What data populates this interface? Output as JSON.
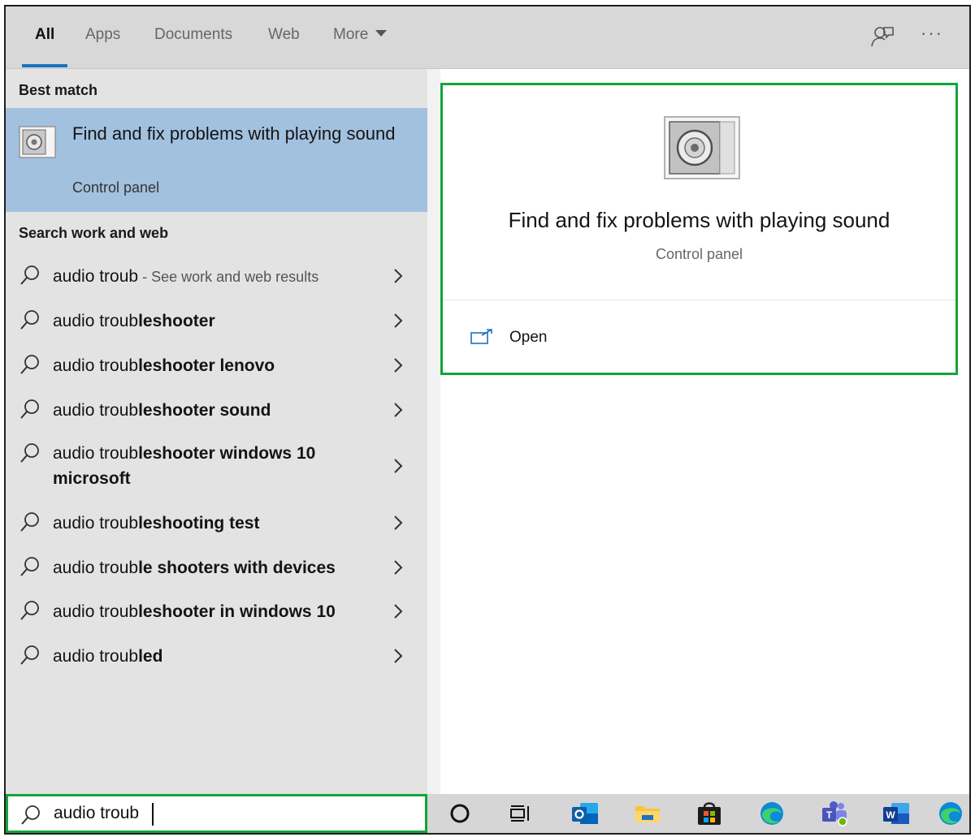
{
  "header": {
    "tabs": [
      {
        "label": "All",
        "active": true
      },
      {
        "label": "Apps"
      },
      {
        "label": "Documents"
      },
      {
        "label": "Web"
      },
      {
        "label": "More"
      }
    ],
    "right_icons": [
      "feedback-icon",
      "more-options-icon"
    ],
    "more_glyph": "···"
  },
  "left_panel": {
    "best_match_heading": "Best match",
    "best_match": {
      "title": "Find and fix problems with playing sound",
      "subtitle": "Control panel",
      "icon": "speaker-icon"
    },
    "search_web_heading": "Search work and web",
    "suggestions": [
      {
        "prefix": "audio troub",
        "bold": "",
        "hint": " - See work and web results"
      },
      {
        "prefix": "audio troub",
        "bold": "leshooter"
      },
      {
        "prefix": "audio troub",
        "bold": "leshooter lenovo"
      },
      {
        "prefix": "audio troub",
        "bold": "leshooter sound"
      },
      {
        "prefix": "audio troub",
        "bold": "leshooter windows 10 microsoft"
      },
      {
        "prefix": "audio troub",
        "bold": "leshooting test"
      },
      {
        "prefix": "audio troub",
        "bold": "le shooters with devices"
      },
      {
        "prefix": "audio troub",
        "bold": "leshooter in windows 10"
      },
      {
        "prefix": "audio troub",
        "bold": "led"
      }
    ]
  },
  "search": {
    "value": "audio troub"
  },
  "detail": {
    "title": "Find and fix problems with playing sound",
    "subtitle": "Control panel",
    "open_label": "Open"
  },
  "taskbar": {
    "items": [
      "cortana-icon",
      "task-view-icon",
      "outlook-icon",
      "file-explorer-icon",
      "microsoft-store-icon",
      "edge-icon",
      "teams-icon",
      "word-icon",
      "edge-icon"
    ]
  },
  "colors": {
    "accent": "#1a73c4",
    "highlight": "#12a538",
    "best_match_bg": "#a2c1df"
  }
}
